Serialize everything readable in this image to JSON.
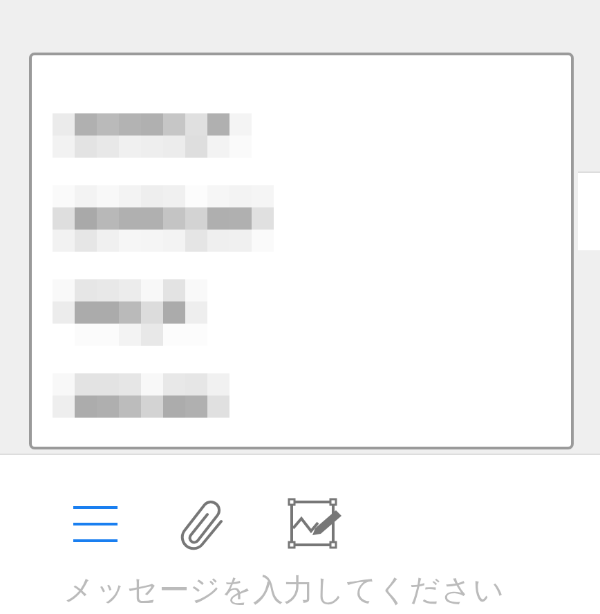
{
  "popup": {
    "items": [
      {
        "kind": "redacted"
      },
      {
        "kind": "redacted"
      },
      {
        "kind": "redacted"
      },
      {
        "kind": "redacted"
      }
    ]
  },
  "toolbar": {
    "buttons": [
      {
        "kind": "menu"
      },
      {
        "kind": "attach"
      },
      {
        "kind": "image-edit"
      }
    ]
  },
  "message": {
    "placeholder": "メッセージを入力してください"
  }
}
